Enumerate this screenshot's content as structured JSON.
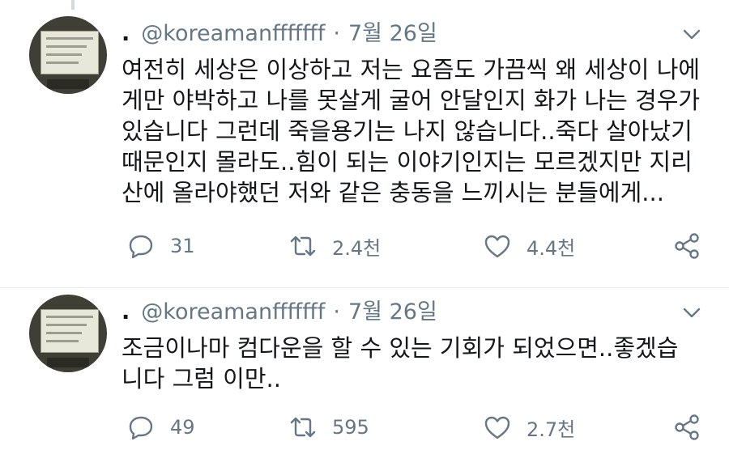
{
  "colors": {
    "text": "#14171a",
    "muted": "#657786",
    "background": "#ffffff"
  },
  "tweets": [
    {
      "display_name": ".",
      "handle": "@koreamanfffffff",
      "separator": "·",
      "date": "7월 26일",
      "text": "여전히 세상은 이상하고 저는 요즘도 가끔씩 왜 세상이 나에\n게만 야박하고 나를 못살게 굴어 안달인지 화가 나는 경우가\n있습니다 그런데 죽을용기는 나지 않습니다..죽다 살아났기\n때문인지 몰라도..힘이 되는 이야기인지는 모르겠지만 지리\n산에 올라야했던 저와 같은 충동을 느끼시는 분들에게...",
      "replies": "31",
      "retweets": "2.4천",
      "likes": "4.4천",
      "icons": [
        "reply-icon",
        "retweet-icon",
        "like-icon",
        "share-icon",
        "chevron-down-icon"
      ]
    },
    {
      "display_name": ".",
      "handle": "@koreamanfffffff",
      "separator": "·",
      "date": "7월 26일",
      "text": "조금이나마 컴다운을 할 수 있는 기회가 되었으면..좋겠습\n니다 그럼 이만..",
      "replies": "49",
      "retweets": "595",
      "likes": "2.7천",
      "icons": [
        "reply-icon",
        "retweet-icon",
        "like-icon",
        "share-icon",
        "chevron-down-icon"
      ]
    }
  ]
}
